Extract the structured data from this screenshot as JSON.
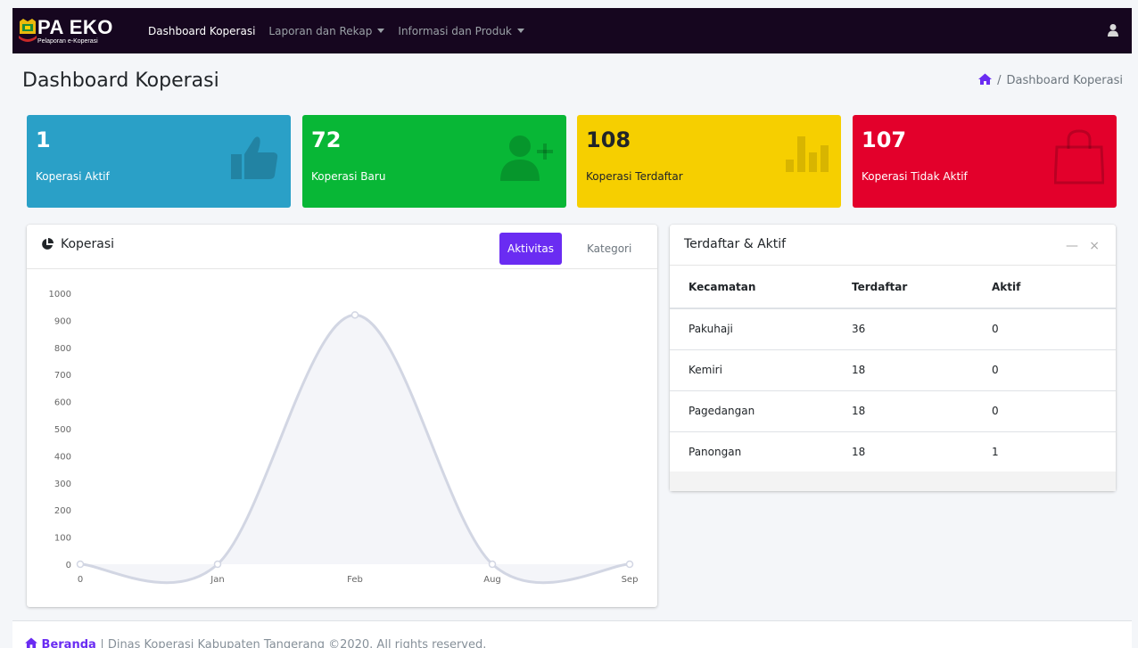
{
  "brand": {
    "title": "PA EKO",
    "subtitle": "Pelaporan e-Koperasi"
  },
  "nav": [
    {
      "label": "Dashboard Koperasi",
      "active": true,
      "dropdown": false
    },
    {
      "label": "Laporan dan Rekap",
      "active": false,
      "dropdown": true
    },
    {
      "label": "Informasi dan Produk",
      "active": false,
      "dropdown": true
    }
  ],
  "page": {
    "title": "Dashboard Koperasi",
    "breadcrumb": [
      "Dashboard Koperasi"
    ]
  },
  "stats": [
    {
      "value": "1",
      "label": "Koperasi Aktif",
      "color": "#2aa0c7",
      "icon": "thumbs-up-icon"
    },
    {
      "value": "72",
      "label": "Koperasi Baru",
      "color": "#08b736",
      "icon": "user-plus-icon"
    },
    {
      "value": "108",
      "label": "Koperasi Terdaftar",
      "color": "#f6cf00",
      "icon": "bar-chart-icon"
    },
    {
      "value": "107",
      "label": "Koperasi Tidak Aktif",
      "color": "#e3002b",
      "icon": "shopping-bag-icon"
    }
  ],
  "chart_card": {
    "title": "Koperasi",
    "tabs": [
      "Aktivitas",
      "Kategori"
    ],
    "active_tab": 0
  },
  "chart_data": {
    "type": "area",
    "categories": [
      "0",
      "Jan",
      "Feb",
      "Aug",
      "Sep"
    ],
    "values": [
      0,
      0,
      920,
      0,
      0
    ],
    "ylim": [
      0,
      1000
    ],
    "yticks": [
      0,
      100,
      200,
      300,
      400,
      500,
      600,
      700,
      800,
      900,
      1000
    ],
    "grid": false,
    "colors": {
      "line": "#d2d6e3",
      "fill": "#f4f5f9"
    }
  },
  "table_card": {
    "title": "Terdaftar & Aktif",
    "headers": [
      "Kecamatan",
      "Terdaftar",
      "Aktif"
    ],
    "rows": [
      [
        "Pakuhaji",
        "36",
        "0"
      ],
      [
        "Kemiri",
        "18",
        "0"
      ],
      [
        "Pagedangan",
        "18",
        "0"
      ],
      [
        "Panongan",
        "18",
        "1"
      ]
    ]
  },
  "footer": {
    "link": "Beranda",
    "text": " | Dinas Koperasi Kabupaten Tangerang ©2020. All rights reserved."
  },
  "colors": {
    "navbar": "#16061f",
    "accent": "#6a2cf2"
  }
}
